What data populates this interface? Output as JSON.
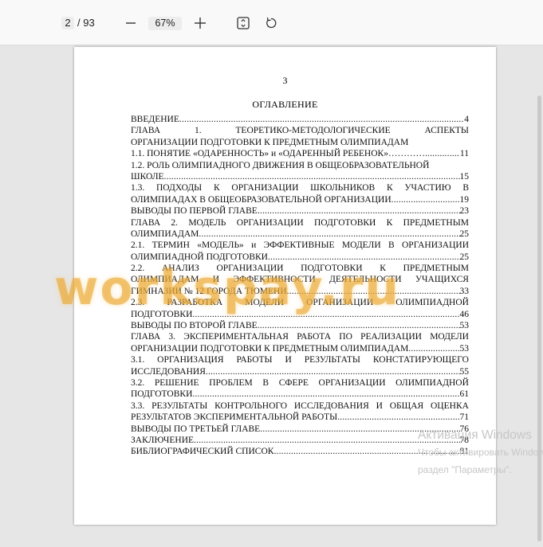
{
  "toolbar": {
    "page_current": "2",
    "page_total": "/ 93",
    "zoom": "67%",
    "zoom_out_icon": "minus-icon",
    "zoom_in_icon": "plus-icon",
    "fit_icon": "fit-page-icon",
    "rotate_icon": "rotate-icon"
  },
  "document": {
    "page_number": "3",
    "toc_title": "ОГЛАВЛЕНИЕ",
    "entries": [
      {
        "lines": [
          {
            "text": "ВВЕДЕНИЕ",
            "page": "4"
          }
        ]
      },
      {
        "lines": [
          {
            "words": [
              "ГЛАВА",
              "1.",
              "ТЕОРЕТИКО-МЕТОДОЛОГИЧЕСКИЕ",
              "АСПЕКТЫ"
            ]
          },
          {
            "text": "ОРГАНИЗАЦИИ ПОДГОТОВКИ К ПРЕДМЕТНЫМ ОЛИМПИАДАМ"
          }
        ]
      },
      {
        "lines": [
          {
            "text": "1.1. ПОНЯТИЕ «ОДАРЕННОСТЬ» и «ОДАРЕННЫЙ РЕБЕНОК»…………",
            "page": "11"
          }
        ]
      },
      {
        "lines": [
          {
            "text": "1.2. РОЛЬ ОЛИМПИАДНОГО ДВИЖЕНИЯ В ОБЩЕОБРАЗОВАТЕЛЬНОЙ"
          },
          {
            "text": "ШКОЛЕ",
            "page": "15"
          }
        ]
      },
      {
        "lines": [
          {
            "words": [
              "1.3.",
              "ПОДХОДЫ",
              "К",
              "ОРГАНИЗАЦИИ",
              "ШКОЛЬНИКОВ",
              "К",
              "УЧАСТИЮ",
              "В"
            ]
          },
          {
            "text": "ОЛИМПИАДАХ В ОБЩЕОБРАЗОВАТЕЛЬНОЙ ОРГАНИЗАЦИИ",
            "page": "19"
          }
        ]
      },
      {
        "lines": [
          {
            "text": "ВЫВОДЫ ПО ПЕРВОЙ ГЛАВЕ",
            "page": "23"
          }
        ]
      },
      {
        "lines": [
          {
            "words": [
              "ГЛАВА",
              "2.",
              "МОДЕЛЬ",
              "ОРГАНИЗАЦИИ",
              "ПОДГОТОВКИ",
              "К",
              "ПРЕДМЕТНЫМ"
            ]
          },
          {
            "text": "ОЛИМПИАДАМ",
            "page": "25"
          }
        ]
      },
      {
        "lines": [
          {
            "words": [
              "2.1.",
              "ТЕРМИН",
              "«МОДЕЛЬ»",
              "и",
              "ЭФФЕКТИВНЫЕ",
              "МОДЕЛИ",
              "В",
              "ОРГАНИЗАЦИИ"
            ]
          },
          {
            "text": "ОЛИМПИАДНОЙ ПОДГОТОВКИ",
            "page": "25"
          }
        ]
      },
      {
        "lines": [
          {
            "words": [
              "2.2.",
              "АНАЛИЗ",
              "ОРГАНИЗАЦИИ",
              "ПОДГОТОВКИ",
              "К",
              "ПРЕДМЕТНЫМ"
            ]
          },
          {
            "words": [
              "ОЛИМПИАДАМ",
              "И",
              "ЭФФЕКТИВНОСТИ",
              "ДЕЯТЕЛЬНОСТИ",
              "УЧАЩИХСЯ"
            ]
          },
          {
            "text": "ГИМНАЗИИ № 12 ГОРОДА ТЮМЕНИ",
            "page": "33"
          }
        ]
      },
      {
        "lines": [
          {
            "words": [
              "2.3.",
              "РАЗРАБОТКА",
              "МОДЕЛИ",
              "ОРГАНИЗАЦИИ",
              "ОЛИМПИАДНОЙ"
            ]
          },
          {
            "text": "ПОДГОТОВКИ",
            "page": "46"
          }
        ]
      },
      {
        "lines": [
          {
            "text": "ВЫВОДЫ ПО ВТОРОЙ ГЛАВЕ",
            "page": "53"
          }
        ]
      },
      {
        "lines": [
          {
            "words": [
              "ГЛАВА",
              "3.",
              "ЭКСПЕРИМЕНТАЛЬНАЯ",
              "РАБОТА",
              "ПО",
              "РЕАЛИЗАЦИИ",
              "МОДЕЛИ"
            ]
          },
          {
            "text": "ОРГАНИЗАЦИИ ПОДГОТОВКИ К ПРЕДМЕТНЫМ ОЛИМПИАДАМ",
            "page": "53"
          }
        ]
      },
      {
        "lines": [
          {
            "words": [
              "3.1.",
              "ОРГАНИЗАЦИЯ",
              "РАБОТЫ",
              "И",
              "РЕЗУЛЬТАТЫ",
              "КОНСТАТИРУЮЩЕГО"
            ]
          },
          {
            "text": "ИССЛЕДОВАНИЯ",
            "page": "55"
          }
        ]
      },
      {
        "lines": [
          {
            "words": [
              "3.2.",
              "РЕШЕНИЕ",
              "ПРОБЛЕМ",
              "В",
              "СФЕРЕ",
              "ОРГАНИЗАЦИИ",
              "ОЛИМПИАДНОЙ"
            ]
          },
          {
            "text": "ПОДГОТОВКИ",
            "page": "61"
          }
        ]
      },
      {
        "lines": [
          {
            "words": [
              "3.3.",
              "РЕЗУЛЬТАТЫ",
              "КОНТРОЛЬНОГО",
              "ИССЛЕДОВАНИЯ",
              "И",
              "ОБЩАЯ",
              "ОЦЕНКА"
            ]
          },
          {
            "text": "РЕЗУЛЬТАТОВ ЭКСПЕРИМЕНТАЛЬНОЙ РАБОТЫ",
            "page": "71"
          }
        ]
      },
      {
        "lines": [
          {
            "text": "ВЫВОДЫ ПО ТРЕТЬЕЙ ГЛАВЕ",
            "page": "76"
          }
        ]
      },
      {
        "lines": [
          {
            "text": "ЗАКЛЮЧЕНИЕ",
            "page": "78"
          }
        ]
      },
      {
        "lines": [
          {
            "text": "БИБЛИОГРАФИЧЕСКИЙ СПИСОК",
            "page": "81"
          }
        ]
      }
    ]
  },
  "watermark": "workspay.ru",
  "windows_activation": {
    "title": "Активация Windows",
    "line1": "Чтобы активировать Windows,",
    "line2": "раздел \"Параметры\"."
  }
}
